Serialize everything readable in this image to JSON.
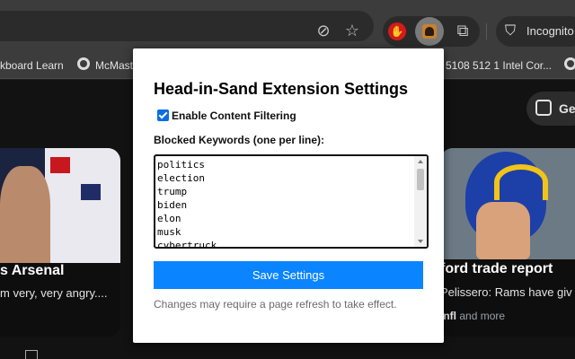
{
  "browser": {
    "profile_label": "Incognito",
    "bookmarks": [
      {
        "label": "kboard Learn"
      },
      {
        "label": "McMast"
      },
      {
        "label": "5108 512 1 Intel Cor..."
      }
    ]
  },
  "page": {
    "lens_label": "Ge",
    "cards": [
      {
        "title": "s Arsenal",
        "subtitle": "m very, very angry...."
      },
      {
        "title": "ford trade report",
        "subtitle": "Pelissero: Rams have giv",
        "source": "/nfl",
        "source_more": "and more"
      }
    ]
  },
  "popup": {
    "title": "Head-in-Sand Extension Settings",
    "enable_label": "Enable Content Filtering",
    "enable_checked": true,
    "keywords_label": "Blocked Keywords (one per line):",
    "keywords": [
      "politics",
      "election",
      "trump",
      "biden",
      "elon",
      "musk",
      "cybertruck"
    ],
    "save_label": "Save Settings",
    "note": "Changes may require a page refresh to take effect."
  },
  "colors": {
    "save_button": "#0a84ff",
    "checkbox": "#0b6de0",
    "extension_icon": "#d51a1a"
  }
}
